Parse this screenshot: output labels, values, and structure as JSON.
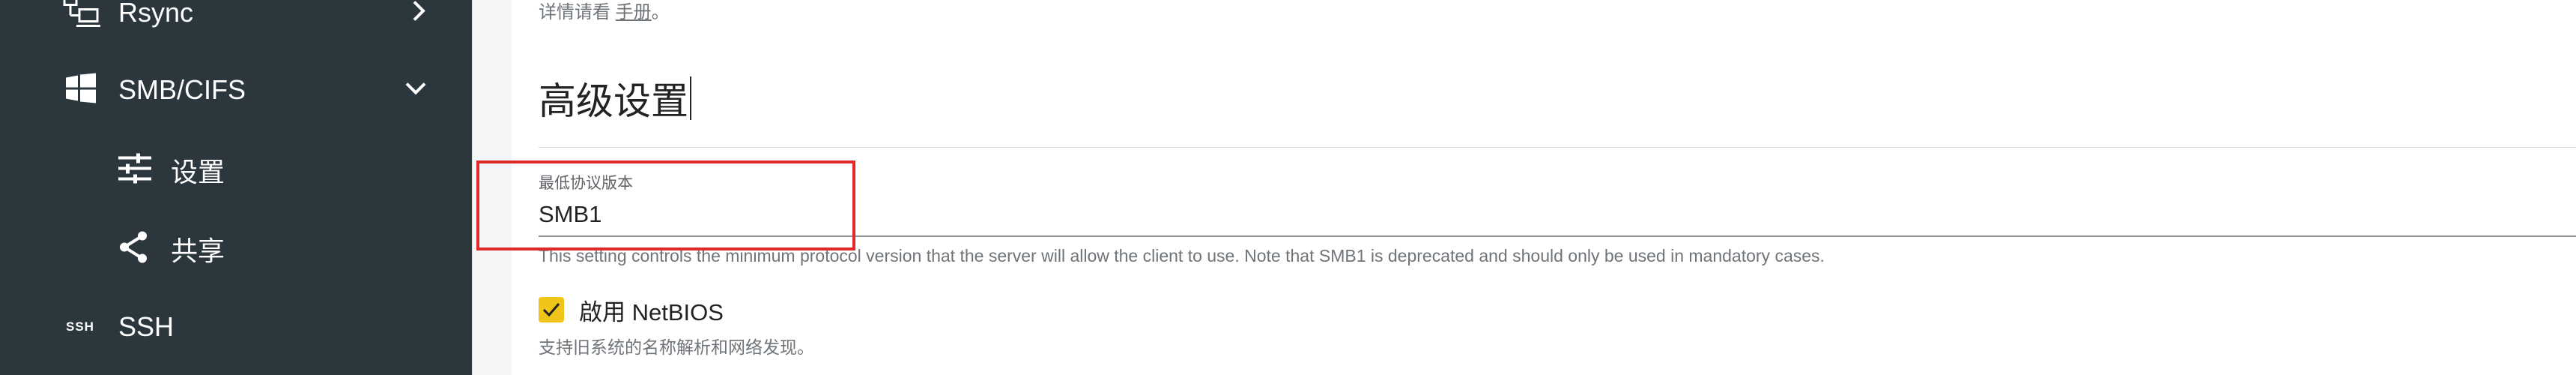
{
  "sidebar": {
    "items": [
      {
        "label": "Rsync",
        "icon": "rsync-icon",
        "chevron": "chevron-right-icon"
      },
      {
        "label": "SMB/CIFS",
        "icon": "windows-icon",
        "chevron": "chevron-down-icon"
      },
      {
        "label": "设置",
        "icon": "tune-icon"
      },
      {
        "label": "共享",
        "icon": "share-icon"
      },
      {
        "label": "SSH",
        "icon": "ssh-icon",
        "badge": "SSH"
      }
    ]
  },
  "main": {
    "hint_prefix": "详情请看",
    "hint_link": "手册",
    "hint_suffix": "。",
    "section_title": "高级设置",
    "min_protocol": {
      "label": "最低协议版本",
      "value": "SMB1",
      "hint": "This setting controls the minimum protocol version that the server will allow the client to use. Note that SMB1 is deprecated and should only be used in mandatory cases."
    },
    "netbios": {
      "label": "啟用 NetBIOS",
      "checked": true,
      "hint": "支持旧系统的名称解析和网络发现。"
    }
  },
  "colors": {
    "sidebar_bg": "#2b363d",
    "checkbox_accent": "#f0c419",
    "highlight": "#e02a2a"
  }
}
